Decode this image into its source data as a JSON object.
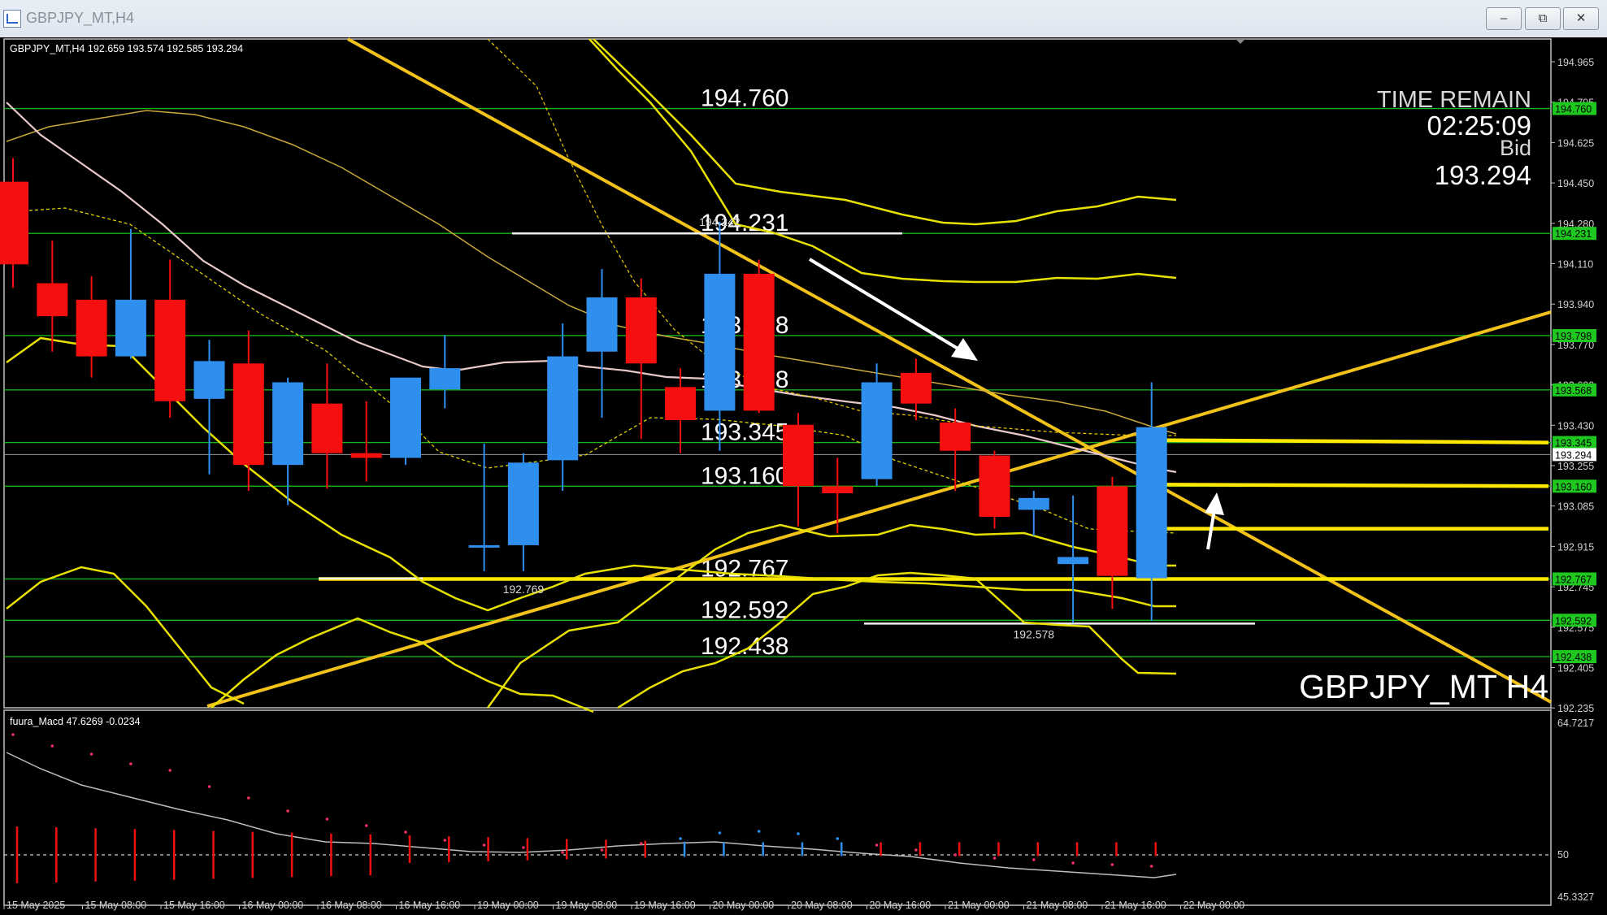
{
  "window": {
    "title": "GBPJPY_MT,H4",
    "buttons": {
      "minimize": "–",
      "maximize": "⧉",
      "close": "✕"
    }
  },
  "chart": {
    "info_line": "GBPJPY_MT,H4  192.659 193.574 192.585 193.294",
    "watermark": "GBPJPY_MT H4",
    "time_remain": {
      "label": "TIME REMAIN",
      "value": "02:25:09",
      "bid_label": "Bid",
      "bid_value": "193.294"
    },
    "indicator_label": "fuura_Macd 47.6269   -0.0234",
    "price_axis_labels": [
      "194.965",
      "194.795",
      "194.625",
      "194.450",
      "194.280",
      "194.110",
      "193.940",
      "193.770",
      "193.600",
      "193.430",
      "193.255",
      "193.085",
      "192.915",
      "192.745",
      "192.575",
      "192.405",
      "192.235"
    ],
    "indicator_axis_labels": [
      "64.7217",
      "50",
      "45.3327"
    ],
    "time_axis_labels": [
      "15 May 2025",
      "15 May 08:00",
      "15 May 16:00",
      "16 May 00:00",
      "16 May 08:00",
      "16 May 16:00",
      "19 May 00:00",
      "19 May 08:00",
      "19 May 16:00",
      "20 May 00:00",
      "20 May 08:00",
      "20 May 16:00",
      "21 May 00:00",
      "21 May 08:00",
      "21 May 16:00",
      "22 May 00:00"
    ],
    "level_labels": [
      "194.760",
      "194.231",
      "193.798",
      "193.568",
      "193.345",
      "193.160",
      "192.767",
      "192.592",
      "192.438"
    ],
    "price_tags": [
      {
        "text": "194.760",
        "color": "#1ec81e"
      },
      {
        "text": "194.231",
        "color": "#1ec81e"
      },
      {
        "text": "193.798",
        "color": "#1ec81e"
      },
      {
        "text": "193.568",
        "color": "#1ec81e"
      },
      {
        "text": "193.345",
        "color": "#1ec81e"
      },
      {
        "text": "193.294",
        "color": "#ffffff"
      },
      {
        "text": "193.160",
        "color": "#1ec81e"
      },
      {
        "text": "192.767",
        "color": "#1ec81e"
      },
      {
        "text": "192.592",
        "color": "#1ec81e"
      },
      {
        "text": "192.438",
        "color": "#1ec81e"
      }
    ],
    "swing_labels": [
      "194.242",
      "192.769",
      "192.578"
    ],
    "colors": {
      "bull": "#2f8fef",
      "bear": "#f50f0f",
      "level_line": "#18b418",
      "trend_line": "#f2c21a",
      "band": "#e8e000"
    }
  },
  "chart_data": {
    "type": "candlestick",
    "symbol": "GBPJPY_MT",
    "timeframe": "H4",
    "x": [
      "15 May 00:00",
      "15 May 04:00",
      "15 May 08:00",
      "15 May 12:00",
      "15 May 16:00",
      "15 May 20:00",
      "16 May 00:00",
      "16 May 04:00",
      "16 May 08:00",
      "16 May 12:00",
      "16 May 16:00",
      "16 May 20:00",
      "19 May 00:00",
      "19 May 04:00",
      "19 May 08:00",
      "19 May 12:00",
      "19 May 16:00",
      "19 May 20:00",
      "20 May 00:00",
      "20 May 04:00",
      "20 May 08:00",
      "20 May 12:00",
      "20 May 16:00",
      "20 May 20:00",
      "21 May 00:00",
      "21 May 04:00",
      "21 May 08:00",
      "21 May 12:00",
      "21 May 16:00",
      "21 May 20:00"
    ],
    "open": [
      194.45,
      194.02,
      193.95,
      193.71,
      193.95,
      193.53,
      193.68,
      193.25,
      193.51,
      193.3,
      193.28,
      193.57,
      192.9,
      192.91,
      193.27,
      193.73,
      193.96,
      193.58,
      193.48,
      194.06,
      193.42,
      193.16,
      193.19,
      193.64,
      193.43,
      193.29,
      193.06,
      192.83,
      193.16,
      192.77
    ],
    "close": [
      194.1,
      193.88,
      193.71,
      193.95,
      193.52,
      193.69,
      193.25,
      193.6,
      193.3,
      193.28,
      193.62,
      193.66,
      192.91,
      193.26,
      193.71,
      193.96,
      193.68,
      193.44,
      194.06,
      193.48,
      193.16,
      193.13,
      193.6,
      193.51,
      193.31,
      193.03,
      193.11,
      192.86,
      192.78,
      193.41
    ],
    "high": [
      194.55,
      194.2,
      194.05,
      194.25,
      194.12,
      193.78,
      193.82,
      193.62,
      193.68,
      193.52,
      193.38,
      193.8,
      193.34,
      193.3,
      193.85,
      194.08,
      194.04,
      193.66,
      194.28,
      194.12,
      193.47,
      193.28,
      193.68,
      193.7,
      193.49,
      193.31,
      193.14,
      193.12,
      193.2,
      193.6
    ],
    "low": [
      194.0,
      193.73,
      193.62,
      193.7,
      193.45,
      193.21,
      193.14,
      193.08,
      193.15,
      193.18,
      193.25,
      193.49,
      192.8,
      192.8,
      193.14,
      193.45,
      193.36,
      193.3,
      193.31,
      193.47,
      192.99,
      192.96,
      193.16,
      193.44,
      193.14,
      192.98,
      192.95,
      192.58,
      192.64,
      192.59
    ],
    "ylim": [
      192.235,
      195.05
    ],
    "horizontal_levels": [
      194.76,
      194.231,
      193.798,
      193.568,
      193.345,
      193.16,
      192.767,
      192.592,
      192.438
    ],
    "current_bid": 193.294,
    "swing_points": [
      {
        "label": "194.242",
        "time": "20 May 00:00",
        "price": 194.242
      },
      {
        "label": "192.769",
        "time": "19 May 04:00",
        "price": 192.769
      },
      {
        "label": "192.578",
        "time": "21 May 08:00",
        "price": 192.578
      }
    ],
    "indicator": {
      "name": "fuura_Macd",
      "values": [
        47.6269,
        -0.0234
      ],
      "ylim": [
        45.3327,
        64.7217
      ],
      "reference_level": 50
    }
  }
}
